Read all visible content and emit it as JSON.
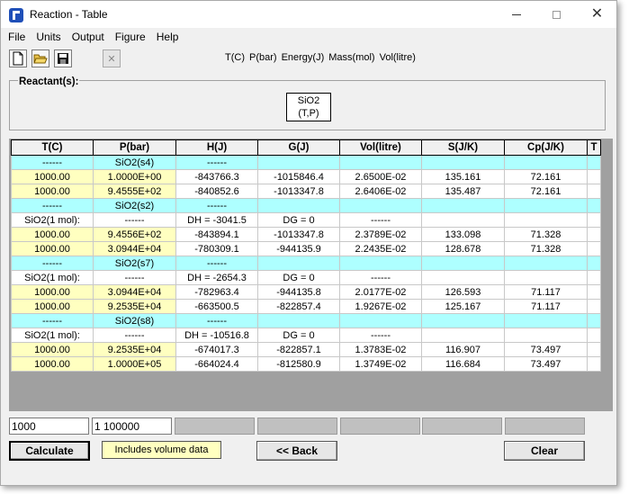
{
  "window": {
    "title": "Reaction - Table",
    "controls": {
      "minimize": "—",
      "maximize": "☐",
      "close": "✕"
    }
  },
  "menu": [
    "File",
    "Units",
    "Output",
    "Figure",
    "Help"
  ],
  "toolbar": {
    "icons": [
      "new-document-icon",
      "open-folder-icon",
      "save-disk-icon",
      "close-x-icon"
    ],
    "units": [
      "T(C)",
      "P(bar)",
      "Energy(J)",
      "Mass(mol)",
      "Vol(litre)"
    ]
  },
  "reactants": {
    "label": "Reactant(s):",
    "species": {
      "name": "SiO2",
      "state": "(T,P)"
    }
  },
  "table": {
    "headers": [
      "T(C)",
      "P(bar)",
      "H(J)",
      "G(J)",
      "Vol(litre)",
      "S(J/K)",
      "Cp(J/K)",
      "T"
    ],
    "rows": [
      {
        "type": "phase",
        "cells": [
          "------",
          "SiO2(s4)",
          "------",
          "",
          "",
          "",
          "",
          ""
        ]
      },
      {
        "type": "data",
        "cells": [
          "1000.00",
          "1.0000E+00",
          "-843766.3",
          "-1015846.4",
          "2.6500E-02",
          "135.161",
          "72.161",
          ""
        ]
      },
      {
        "type": "data",
        "cells": [
          "1000.00",
          "9.4555E+02",
          "-840852.6",
          "-1013347.8",
          "2.6406E-02",
          "135.487",
          "72.161",
          ""
        ]
      },
      {
        "type": "phase",
        "cells": [
          "------",
          "SiO2(s2)",
          "------",
          "",
          "",
          "",
          "",
          ""
        ]
      },
      {
        "type": "info",
        "cells": [
          "SiO2(1 mol):",
          "------",
          "DH = -3041.5",
          "DG = 0",
          "------",
          "",
          "",
          ""
        ]
      },
      {
        "type": "data",
        "cells": [
          "1000.00",
          "9.4556E+02",
          "-843894.1",
          "-1013347.8",
          "2.3789E-02",
          "133.098",
          "71.328",
          ""
        ]
      },
      {
        "type": "data",
        "cells": [
          "1000.00",
          "3.0944E+04",
          "-780309.1",
          "-944135.9",
          "2.2435E-02",
          "128.678",
          "71.328",
          ""
        ]
      },
      {
        "type": "phase",
        "cells": [
          "------",
          "SiO2(s7)",
          "------",
          "",
          "",
          "",
          "",
          ""
        ]
      },
      {
        "type": "info",
        "cells": [
          "SiO2(1 mol):",
          "------",
          "DH = -2654.3",
          "DG = 0",
          "------",
          "",
          "",
          ""
        ]
      },
      {
        "type": "data",
        "cells": [
          "1000.00",
          "3.0944E+04",
          "-782963.4",
          "-944135.8",
          "2.0177E-02",
          "126.593",
          "71.117",
          ""
        ]
      },
      {
        "type": "data",
        "cells": [
          "1000.00",
          "9.2535E+04",
          "-663500.5",
          "-822857.4",
          "1.9267E-02",
          "125.167",
          "71.117",
          ""
        ]
      },
      {
        "type": "phase",
        "cells": [
          "------",
          "SiO2(s8)",
          "------",
          "",
          "",
          "",
          "",
          ""
        ]
      },
      {
        "type": "info",
        "cells": [
          "SiO2(1 mol):",
          "------",
          "DH = -10516.8",
          "DG = 0",
          "------",
          "",
          "",
          ""
        ]
      },
      {
        "type": "data",
        "cells": [
          "1000.00",
          "9.2535E+04",
          "-674017.3",
          "-822857.1",
          "1.3783E-02",
          "116.907",
          "73.497",
          ""
        ]
      },
      {
        "type": "data",
        "cells": [
          "1000.00",
          "1.0000E+05",
          "-664024.4",
          "-812580.9",
          "1.3749E-02",
          "116.684",
          "73.497",
          ""
        ]
      }
    ]
  },
  "inputs": {
    "temperature": "1000",
    "pressure": "1 100000"
  },
  "buttons": {
    "calculate": "Calculate",
    "back": "<< Back",
    "clear": "Clear"
  },
  "note": "Includes volume data"
}
